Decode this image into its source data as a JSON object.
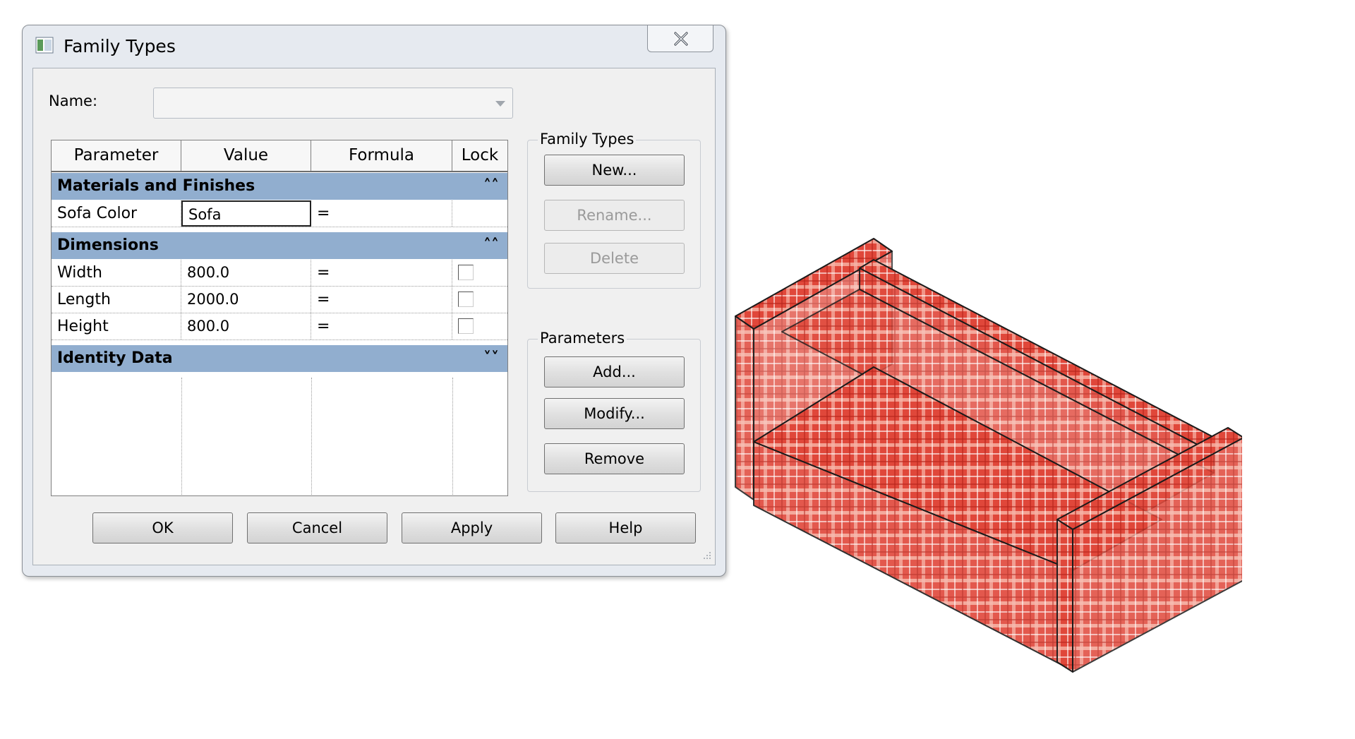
{
  "window": {
    "title": "Family Types"
  },
  "name_field": {
    "label": "Name:",
    "value": ""
  },
  "table": {
    "headers": [
      "Parameter",
      "Value",
      "Formula",
      "Lock"
    ],
    "groups": [
      {
        "label": "Materials and Finishes",
        "chevron": "collapse-icon",
        "rows": [
          {
            "parameter": "Sofa Color",
            "value": "Sofa",
            "formula": "=",
            "has_lock": false
          }
        ]
      },
      {
        "label": "Dimensions",
        "chevron": "collapse-icon",
        "rows": [
          {
            "parameter": "Width",
            "value": "800.0",
            "formula": "=",
            "has_lock": true,
            "locked": false
          },
          {
            "parameter": "Length",
            "value": "2000.0",
            "formula": "=",
            "has_lock": true,
            "locked": false
          },
          {
            "parameter": "Height",
            "value": "800.0",
            "formula": "=",
            "has_lock": true,
            "locked": false
          }
        ]
      },
      {
        "label": "Identity Data",
        "chevron": "expand-icon",
        "rows": []
      }
    ]
  },
  "family_types_panel": {
    "title": "Family Types",
    "new_label": "New...",
    "rename_label": "Rename...",
    "delete_label": "Delete"
  },
  "parameters_panel": {
    "title": "Parameters",
    "add_label": "Add...",
    "modify_label": "Modify...",
    "remove_label": "Remove"
  },
  "footer": {
    "ok_label": "OK",
    "cancel_label": "Cancel",
    "apply_label": "Apply",
    "help_label": "Help"
  },
  "colors": {
    "group_header": "#91aecf",
    "sofa_fabric": "#e0473a"
  }
}
